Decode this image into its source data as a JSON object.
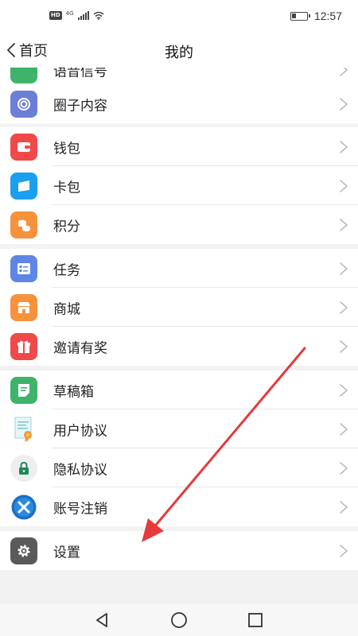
{
  "status_bar": {
    "network_badge": "HD",
    "network_type": "4G",
    "time": "12:57",
    "battery_level": 0.3
  },
  "nav": {
    "back_label": "首页",
    "title": "我的"
  },
  "menu": {
    "partial_label": "语音信号",
    "circle_content": "圈子内容",
    "wallet": "钱包",
    "card_wallet": "卡包",
    "points": "积分",
    "tasks": "任务",
    "mall": "商城",
    "invite_reward": "邀请有奖",
    "drafts": "草稿箱",
    "user_agreement": "用户协议",
    "privacy_policy": "隐私协议",
    "account_cancel": "账号注销",
    "settings": "设置"
  },
  "colors": {
    "partial": "#3db36b",
    "circle_content": "#6b7fd6",
    "wallet": "#f0494a",
    "card_wallet": "#1b9ff0",
    "points": "#f5923b",
    "tasks": "#5f86e6",
    "mall": "#f5923b",
    "invite_reward": "#f0494a",
    "drafts": "#3db36b",
    "settings": "#5a5a5a",
    "arrow": "#e53a3a"
  }
}
